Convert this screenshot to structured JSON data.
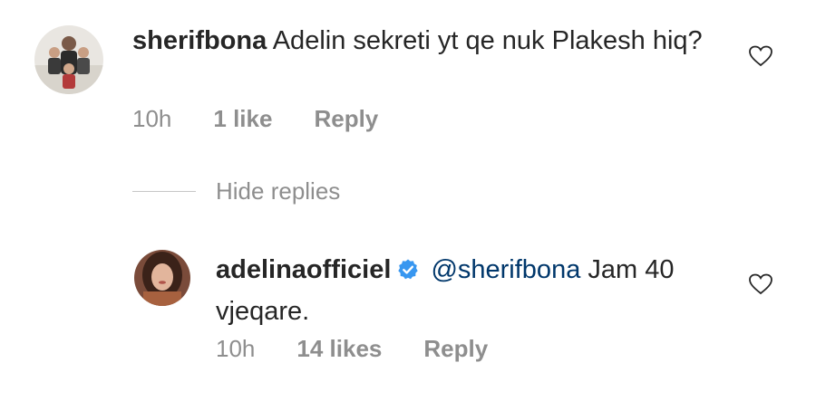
{
  "comments": [
    {
      "username": "sherifbona",
      "text": "Adelin sekreti yt qe nuk Plakesh hiq?",
      "time": "10h",
      "likes": "1 like",
      "reply": "Reply",
      "verified": false
    }
  ],
  "hide_replies": "Hide replies",
  "replies": [
    {
      "username": "adelinaofficiel",
      "mention": "@sherifbona",
      "text": "Jam 40 vjeqare.",
      "time": "10h",
      "likes": "14 likes",
      "reply": "Reply",
      "verified": true
    }
  ],
  "colors": {
    "text": "#262626",
    "meta": "#8e8e8e",
    "mention": "#00376b",
    "verified": "#3897f0"
  },
  "icons": [
    "heart-outline-icon",
    "verified-badge-icon"
  ]
}
